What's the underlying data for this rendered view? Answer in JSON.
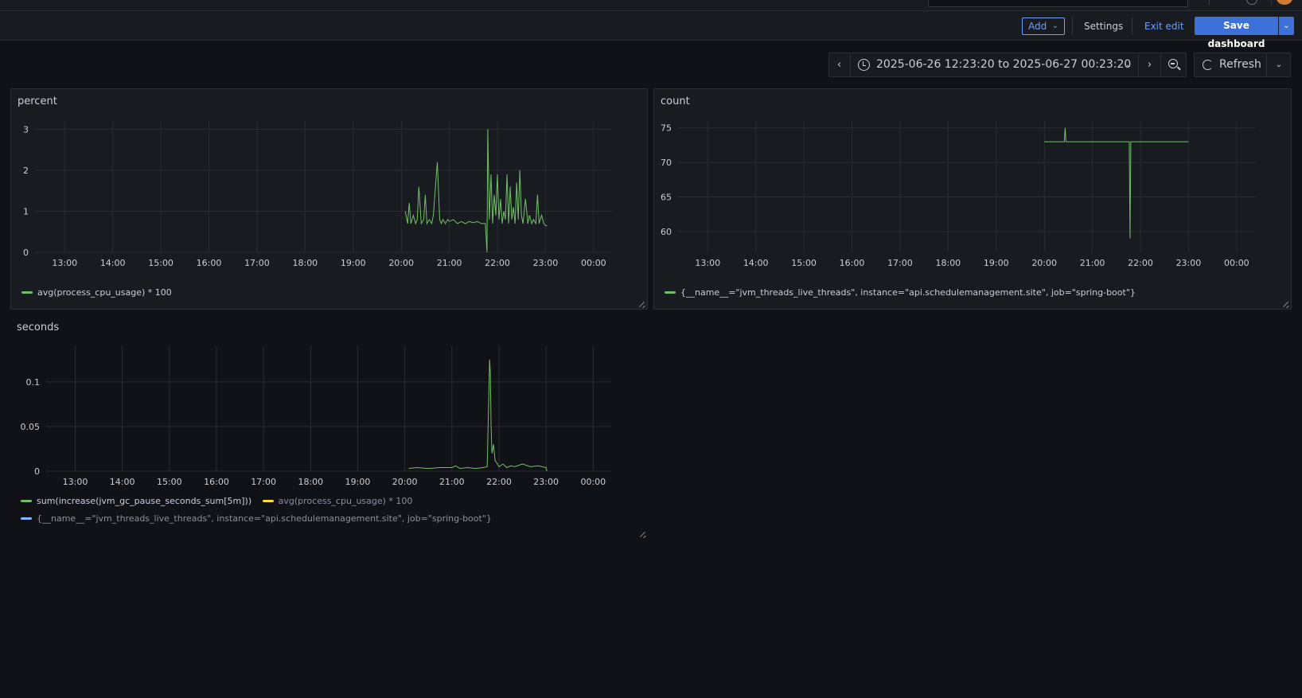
{
  "toolbar": {
    "add_label": "Add",
    "settings_label": "Settings",
    "exit_edit_label": "Exit edit",
    "save_label": "Save dashboard"
  },
  "time_picker": {
    "range_label": "2025-06-26 12:23:20 to 2025-06-27 00:23:20",
    "refresh_label": "Refresh"
  },
  "colors": {
    "series_green": "#73bf69",
    "series_yellow": "#fade2a",
    "series_blue": "#8ab8ff",
    "accent": "#3d71d9"
  },
  "panels": [
    {
      "title": "percent",
      "legend": [
        {
          "label": "avg(process_cpu_usage) * 100",
          "color": "#73bf69"
        }
      ]
    },
    {
      "title": "count",
      "legend": [
        {
          "label": "{__name__=\"jvm_threads_live_threads\", instance=\"api.schedulemanagement.site\", job=\"spring-boot\"}",
          "color": "#73bf69"
        }
      ]
    },
    {
      "title": "seconds",
      "legend": [
        {
          "label": "sum(increase(jvm_gc_pause_seconds_sum[5m]))",
          "color": "#73bf69"
        },
        {
          "label": "avg(process_cpu_usage) * 100",
          "color": "#fade2a"
        },
        {
          "label": "{__name__=\"jvm_threads_live_threads\", instance=\"api.schedulemanagement.site\", job=\"spring-boot\"}",
          "color": "#8ab8ff"
        }
      ]
    }
  ],
  "chart_data": [
    {
      "type": "line",
      "title": "percent",
      "x_ticks": [
        "13:00",
        "14:00",
        "15:00",
        "16:00",
        "17:00",
        "18:00",
        "19:00",
        "20:00",
        "21:00",
        "22:00",
        "23:00",
        "00:00"
      ],
      "y_ticks": [
        0,
        1,
        2,
        3
      ],
      "ylim": [
        0,
        3.2
      ],
      "xlim": [
        "12:23",
        "00:23"
      ],
      "grid": true,
      "legend_placement": "bottom-left",
      "series": [
        {
          "name": "avg(process_cpu_usage) * 100",
          "color": "#73bf69",
          "x": [
            "20:05",
            "20:08",
            "20:10",
            "20:12",
            "20:15",
            "20:18",
            "20:20",
            "20:22",
            "20:25",
            "20:28",
            "20:30",
            "20:32",
            "20:35",
            "20:38",
            "20:40",
            "20:45",
            "20:48",
            "20:50",
            "20:52",
            "20:55",
            "20:58",
            "21:00",
            "21:05",
            "21:10",
            "21:15",
            "21:20",
            "21:25",
            "21:30",
            "21:35",
            "21:40",
            "21:45",
            "21:47",
            "21:48",
            "21:50",
            "21:52",
            "21:54",
            "21:56",
            "21:58",
            "22:00",
            "22:02",
            "22:04",
            "22:06",
            "22:08",
            "22:10",
            "22:12",
            "22:14",
            "22:16",
            "22:18",
            "22:20",
            "22:22",
            "22:24",
            "22:26",
            "22:28",
            "22:30",
            "22:32",
            "22:35",
            "22:38",
            "22:40",
            "22:43",
            "22:45",
            "22:48",
            "22:50",
            "22:52",
            "22:55",
            "22:58",
            "23:00",
            "23:02"
          ],
          "values": [
            1.0,
            0.7,
            1.2,
            0.7,
            0.9,
            0.7,
            0.8,
            1.6,
            0.7,
            0.8,
            1.4,
            0.7,
            0.8,
            0.7,
            0.9,
            2.2,
            0.8,
            0.7,
            0.8,
            0.7,
            0.8,
            0.75,
            0.8,
            0.7,
            0.75,
            0.7,
            0.75,
            0.72,
            0.75,
            0.7,
            0.7,
            0.0,
            3.0,
            0.8,
            1.9,
            0.7,
            1.4,
            0.9,
            1.9,
            0.8,
            1.3,
            0.7,
            1.0,
            0.8,
            1.9,
            0.7,
            1.6,
            0.8,
            1.1,
            0.7,
            1.7,
            0.8,
            2.0,
            0.9,
            0.7,
            1.3,
            0.7,
            0.9,
            0.7,
            0.8,
            0.7,
            1.4,
            0.7,
            0.9,
            0.7,
            0.65,
            0.65
          ]
        }
      ]
    },
    {
      "type": "line",
      "title": "count",
      "x_ticks": [
        "13:00",
        "14:00",
        "15:00",
        "16:00",
        "17:00",
        "18:00",
        "19:00",
        "20:00",
        "21:00",
        "22:00",
        "23:00",
        "00:00"
      ],
      "y_ticks": [
        60,
        65,
        70,
        75
      ],
      "ylim": [
        57,
        76
      ],
      "xlim": [
        "12:23",
        "00:23"
      ],
      "grid": true,
      "legend_placement": "bottom-left",
      "series": [
        {
          "name": "{__name__=\"jvm_threads_live_threads\", instance=\"api.schedulemanagement.site\", job=\"spring-boot\"}",
          "color": "#73bf69",
          "x": [
            "20:00",
            "20:20",
            "20:25",
            "20:26",
            "20:27",
            "21:45",
            "21:46",
            "21:47",
            "21:48",
            "23:00"
          ],
          "values": [
            73,
            73,
            73,
            75,
            73,
            73,
            73,
            59,
            73,
            73
          ]
        }
      ]
    },
    {
      "type": "line",
      "title": "seconds",
      "x_ticks": [
        "13:00",
        "14:00",
        "15:00",
        "16:00",
        "17:00",
        "18:00",
        "19:00",
        "20:00",
        "21:00",
        "22:00",
        "23:00",
        "00:00"
      ],
      "y_ticks": [
        "0",
        "0.05",
        "0.1"
      ],
      "ylim": [
        0,
        0.14
      ],
      "xlim": [
        "12:23",
        "00:23"
      ],
      "grid": true,
      "legend_placement": "bottom-left",
      "series": [
        {
          "name": "sum(increase(jvm_gc_pause_seconds_sum[5m]))",
          "color": "#73bf69",
          "x": [
            "20:05",
            "20:15",
            "20:30",
            "20:45",
            "21:00",
            "21:05",
            "21:10",
            "21:20",
            "21:30",
            "21:40",
            "21:45",
            "21:48",
            "21:49",
            "21:50",
            "21:51",
            "21:53",
            "21:55",
            "21:58",
            "22:00",
            "22:05",
            "22:10",
            "22:15",
            "22:20",
            "22:30",
            "22:40",
            "22:50",
            "23:00",
            "23:01"
          ],
          "values": [
            0.003,
            0.004,
            0.003,
            0.004,
            0.004,
            0.006,
            0.003,
            0.004,
            0.003,
            0.004,
            0.005,
            0.125,
            0.11,
            0.05,
            0.02,
            0.03,
            0.012,
            0.008,
            0.005,
            0.008,
            0.004,
            0.006,
            0.005,
            0.008,
            0.005,
            0.006,
            0.004,
            0.0
          ]
        }
      ]
    }
  ]
}
